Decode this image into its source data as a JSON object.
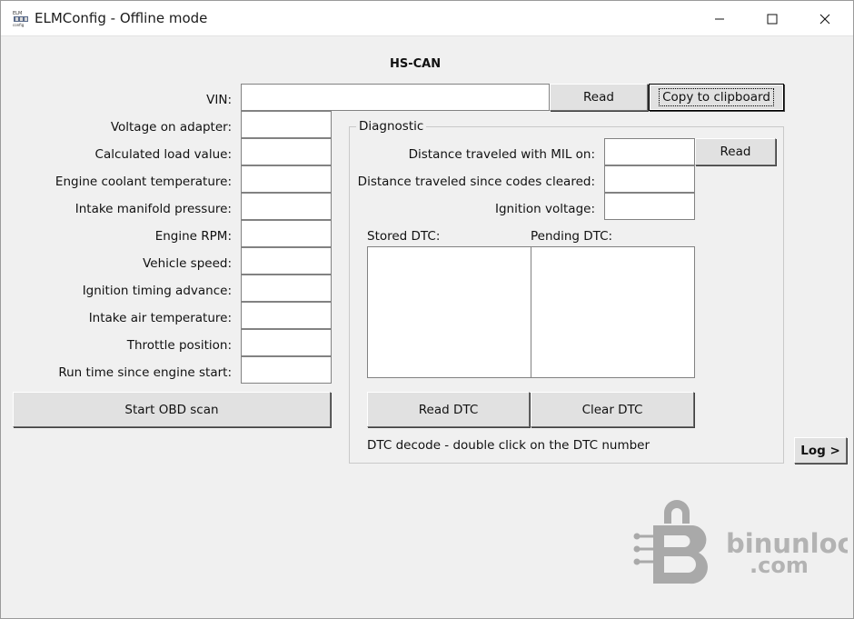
{
  "window": {
    "title": "ELMConfig - Offline mode"
  },
  "section_title": "HS-CAN",
  "vin": {
    "label": "VIN:",
    "value": "",
    "read_label": "Read",
    "copy_label": "Copy to clipboard"
  },
  "params": [
    {
      "label": "Voltage on adapter:",
      "value": ""
    },
    {
      "label": "Calculated load value:",
      "value": ""
    },
    {
      "label": "Engine coolant temperature:",
      "value": ""
    },
    {
      "label": "Intake manifold pressure:",
      "value": ""
    },
    {
      "label": "Engine RPM:",
      "value": ""
    },
    {
      "label": "Vehicle speed:",
      "value": ""
    },
    {
      "label": "Ignition timing advance:",
      "value": ""
    },
    {
      "label": "Intake air temperature:",
      "value": ""
    },
    {
      "label": "Throttle position:",
      "value": ""
    },
    {
      "label": "Run time since engine start:",
      "value": ""
    }
  ],
  "start_scan_label": "Start OBD scan",
  "diagnostic": {
    "title": "Diagnostic",
    "mil_label": "Distance traveled with MIL on:",
    "cleared_label": "Distance traveled since codes cleared:",
    "ignition_label": "Ignition voltage:",
    "read_label": "Read",
    "stored_label": "Stored DTC:",
    "pending_label": "Pending DTC:",
    "read_dtc_label": "Read DTC",
    "clear_dtc_label": "Clear DTC",
    "hint": "DTC decode - double click on the DTC number"
  },
  "log_label": "Log >",
  "watermark": {
    "line1": "binunlock",
    "line2": ".com"
  },
  "colors": {
    "face": "#f0f0f0",
    "field": "#ffffff",
    "button": "#e1e1e1"
  }
}
